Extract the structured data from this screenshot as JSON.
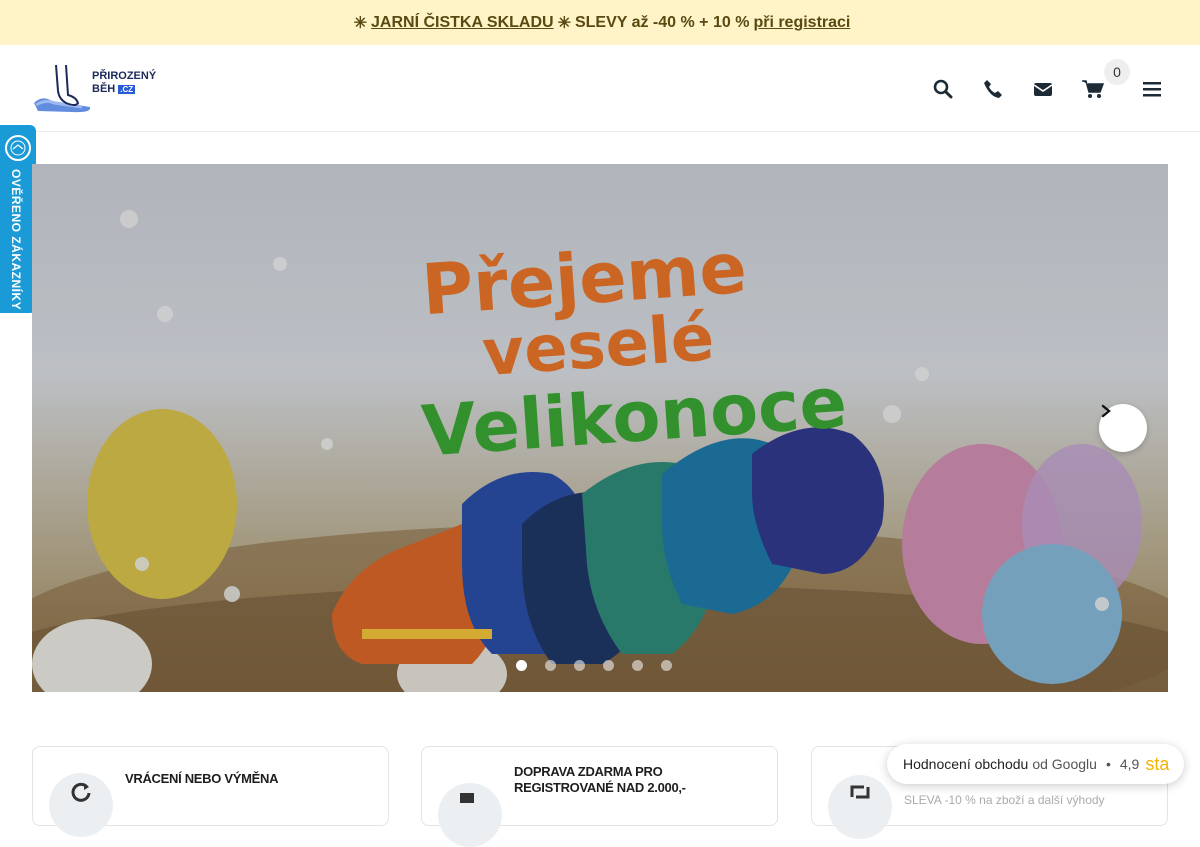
{
  "promo": {
    "star1": "✳",
    "link1": "JARNÍ ČISTKA SKLADU",
    "star2": "✳",
    "text": "SLEVY až -40 % + 10 %",
    "link2": "při registraci",
    "trail": ""
  },
  "header": {
    "logo_line1": "PŘIROZENÝ",
    "logo_line2": "BĚH",
    "logo_cz": ".CZ",
    "cart_count": "0",
    "icons": [
      "search-icon",
      "phone-icon",
      "envelope-icon",
      "cart-icon",
      "menu-icon"
    ]
  },
  "side_tab": {
    "label": "OVĚŘENO ZÁKAZNÍKY",
    "badge_text": "ověřeno zákazníky"
  },
  "hero": {
    "headline": [
      "Přejeme",
      "veselé",
      "Velikonoce"
    ],
    "slide_count": 6,
    "active_slide": 1
  },
  "features": [
    {
      "title": "VRÁCENÍ NEBO VÝMĚNA",
      "subtitle": "",
      "icon": "refresh-icon"
    },
    {
      "title": "DOPRAVA ZDARMA PRO REGISTROVANÉ NAD 2.000,-",
      "subtitle": "",
      "icon": "truck-icon"
    },
    {
      "title": "",
      "subtitle": "SLEVA -10 % na zboží a další výhody",
      "icon": "retweet-icon"
    }
  ],
  "rating": {
    "label": "Hodnocení obchodu",
    "source": "od Googlu",
    "sep": "•",
    "score": "4,9",
    "stars_text": "sta"
  },
  "colors": {
    "promo_bg": "#fff4c8",
    "side_tab": "#1a9ad6",
    "headline_orange": "#e8742a",
    "headline_green": "#3aa534"
  }
}
